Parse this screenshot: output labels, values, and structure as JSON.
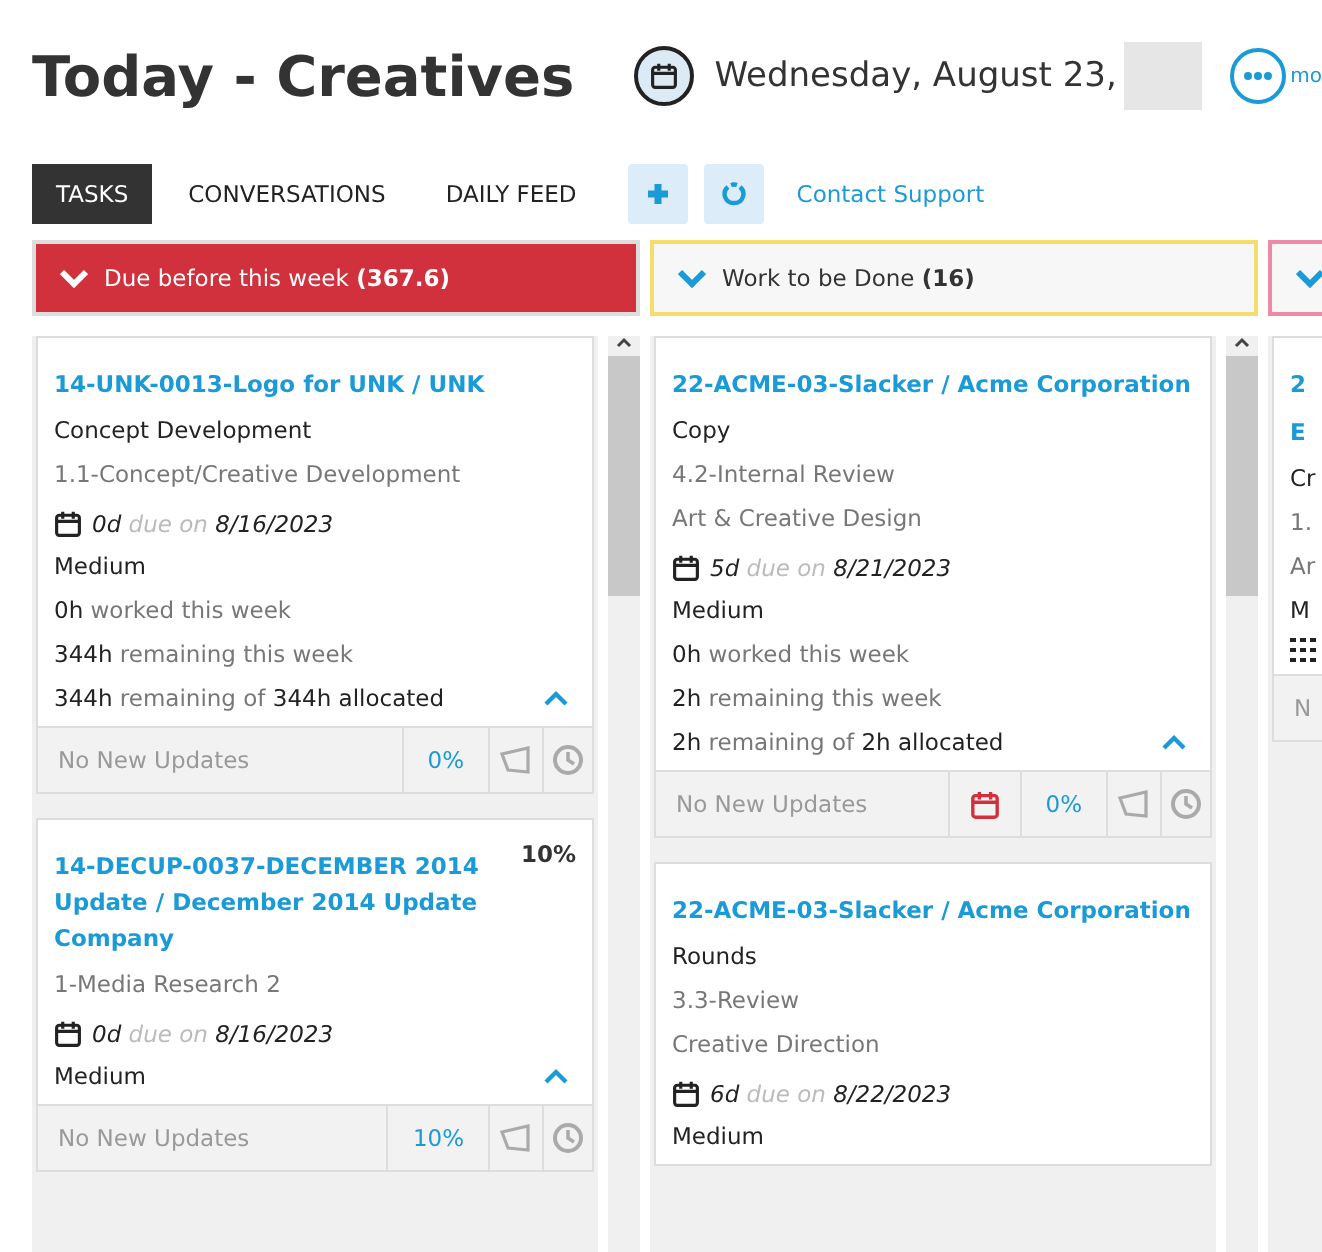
{
  "page": {
    "title": "Today - Creatives",
    "date": "Wednesday, August 23,",
    "more_label": "mo"
  },
  "tabs": [
    {
      "label": "TASKS",
      "selected": true
    },
    {
      "label": "CONVERSATIONS",
      "selected": false
    },
    {
      "label": "DAILY FEED",
      "selected": false
    }
  ],
  "toolbar": {
    "support_link": "Contact Support"
  },
  "columns": [
    {
      "title": "Due before this week",
      "count": "(367.6)",
      "kind": "overdue",
      "color": "#d0313d",
      "tasks": [
        {
          "title": "14-UNK-0013-Logo for UNK / UNK",
          "details": [
            {
              "text": "Concept Development",
              "kind": "primary"
            },
            {
              "text": "1.1-Concept/Creative Development",
              "kind": "secondary"
            }
          ],
          "due": {
            "days": "0d",
            "label": "due on",
            "date": "8/16/2023"
          },
          "priority": "Medium",
          "hours": [
            {
              "amount": "0h",
              "text": "worked this week"
            },
            {
              "amount": "344h",
              "text": "remaining this week"
            },
            {
              "amount": "344h",
              "text": "remaining of",
              "total": "344h allocated"
            }
          ],
          "expanded": true,
          "footer": {
            "updates": "No New Updates",
            "overdue": false,
            "percent": "0%"
          }
        },
        {
          "title": "14-DECUP-0037-DECEMBER 2014 Update / December 2014 Update Company",
          "progress_label": "10%",
          "details": [
            {
              "text": "1-Media Research 2",
              "kind": "secondary"
            }
          ],
          "due": {
            "days": "0d",
            "label": "due on",
            "date": "8/16/2023"
          },
          "priority": "Medium",
          "expanded": true,
          "footer": {
            "updates": "No New Updates",
            "overdue": false,
            "percent": "10%"
          }
        }
      ]
    },
    {
      "title": "Work to be Done",
      "count": "(16)",
      "kind": "pending",
      "color": "#f5dd6b",
      "tasks": [
        {
          "title": "22-ACME-03-Slacker / Acme Corporation",
          "details": [
            {
              "text": "Copy",
              "kind": "primary"
            },
            {
              "text": "4.2-Internal Review",
              "kind": "secondary"
            },
            {
              "text": "Art & Creative Design",
              "kind": "secondary"
            }
          ],
          "due": {
            "days": "5d",
            "label": "due on",
            "date": "8/21/2023"
          },
          "priority": "Medium",
          "hours": [
            {
              "amount": "0h",
              "text": "worked this week"
            },
            {
              "amount": "2h",
              "text": "remaining this week"
            },
            {
              "amount": "2h",
              "text": "remaining of",
              "total": "2h allocated"
            }
          ],
          "expanded": true,
          "footer": {
            "updates": "No New Updates",
            "overdue": true,
            "percent": "0%"
          }
        },
        {
          "title": "22-ACME-03-Slacker / Acme Corporation",
          "details": [
            {
              "text": "Rounds",
              "kind": "primary"
            },
            {
              "text": "3.3-Review",
              "kind": "secondary"
            },
            {
              "text": "Creative Direction",
              "kind": "secondary"
            }
          ],
          "due": {
            "days": "6d",
            "label": "due on",
            "date": "8/22/2023"
          },
          "priority": "Medium"
        }
      ]
    },
    {
      "kind": "pending",
      "color": "#ee8aa8",
      "tasks": [
        {
          "title": "2",
          "title_line_2": "E",
          "details": [
            {
              "text": "Cr",
              "kind": "primary"
            },
            {
              "text": "1.",
              "kind": "secondary"
            },
            {
              "text": "Ar",
              "kind": "secondary"
            }
          ],
          "priority": "M",
          "grid": true,
          "footer": {
            "updates": "N"
          }
        }
      ]
    }
  ]
}
